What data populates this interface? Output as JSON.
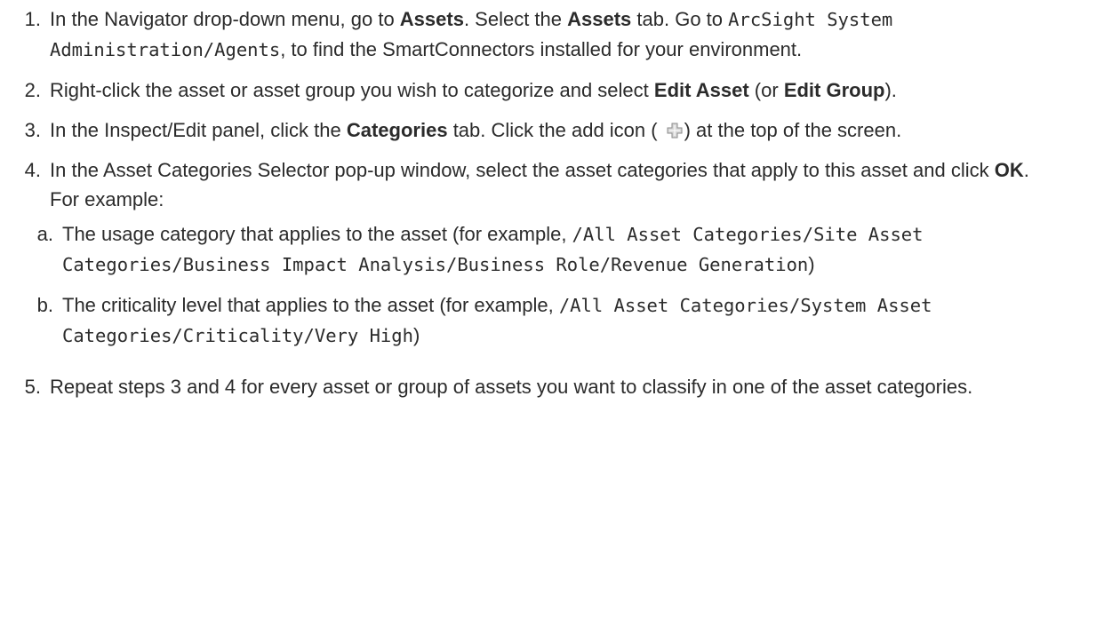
{
  "steps": [
    {
      "num": "1.",
      "p1": "In the Navigator drop-down menu, go to ",
      "b1": "Assets",
      "p2": ". Select the ",
      "b2": "Assets",
      "p3": " tab. Go to ",
      "code1": "ArcSight System Administration/Agents",
      "p4": ", to find the SmartConnectors installed for your environment."
    },
    {
      "num": "2.",
      "p1": "Right-click the asset or asset group you wish to categorize and select ",
      "b1": "Edit Asset",
      "p2": " (or ",
      "b2": "Edit Group",
      "p3": ")."
    },
    {
      "num": "3.",
      "p1": "In the Inspect/Edit panel, click the ",
      "b1": "Categories",
      "p2": " tab. Click the add icon (",
      "icon": "add-icon",
      "p3": ") at the top of the screen."
    },
    {
      "num": "4.",
      "p1": "In the Asset Categories Selector pop-up window, select the asset categories that apply to this asset and click ",
      "b1": "OK",
      "p2": ". For example:",
      "subs": [
        {
          "num": "a.",
          "p1": "The usage category that applies to the asset (for example, ",
          "code1": "/All Asset Categories/Site Asset Categories/Business Impact Analysis/Business Role/Revenue Generation",
          "p2": ")"
        },
        {
          "num": "b.",
          "p1": "The criticality level that applies to the asset (for example, ",
          "code1": "/All Asset Categories/System Asset Categories/Criticality/Very High",
          "p2": ")"
        }
      ]
    },
    {
      "num": "5.",
      "p1": "Repeat steps 3 and 4 for every asset or group of assets you want to classify in one of the asset categories."
    }
  ],
  "colors": {
    "text": "#2b2b2b",
    "icon_fill": "#d8d8d8",
    "icon_stroke": "#8a8a8a"
  }
}
